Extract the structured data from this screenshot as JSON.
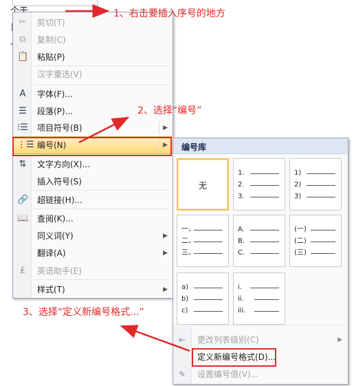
{
  "document": {
    "line1": "个于",
    "marks": [
      "日",
      "人"
    ]
  },
  "context_menu": {
    "items": [
      {
        "label": "剪切(T)",
        "icon": "scissors-icon",
        "glyph": "✂",
        "disabled": true
      },
      {
        "label": "复制(C)",
        "icon": "copy-icon",
        "glyph": "⧉",
        "disabled": true
      },
      {
        "label": "粘贴(P)",
        "icon": "paste-icon",
        "glyph": "📋",
        "disabled": false
      },
      {
        "label": "汉字重选(V)",
        "icon": "",
        "glyph": "",
        "disabled": true
      },
      {
        "label": "字体(F)...",
        "icon": "font-icon",
        "glyph": "A",
        "disabled": false
      },
      {
        "label": "段落(P)...",
        "icon": "paragraph-icon",
        "glyph": "☰",
        "disabled": false
      },
      {
        "label": "项目符号(B)",
        "icon": "bullets-icon",
        "glyph": "⁝☰",
        "disabled": false,
        "submenu": true
      },
      {
        "label": "编号(N)",
        "icon": "numbering-icon",
        "glyph": "⋮☰",
        "disabled": false,
        "submenu": true,
        "highlighted": true
      },
      {
        "label": "文字方向(X)...",
        "icon": "text-direction-icon",
        "glyph": "⇅",
        "disabled": false
      },
      {
        "label": "插入符号(S)",
        "icon": "",
        "glyph": "",
        "disabled": false
      },
      {
        "label": "超链接(H)...",
        "icon": "hyperlink-icon",
        "glyph": "🔗",
        "disabled": false
      },
      {
        "label": "查阅(K)...",
        "icon": "research-icon",
        "glyph": "📖",
        "disabled": false
      },
      {
        "label": "同义词(Y)",
        "icon": "",
        "glyph": "",
        "disabled": false,
        "submenu": true
      },
      {
        "label": "翻译(A)",
        "icon": "",
        "glyph": "",
        "disabled": false,
        "submenu": true
      },
      {
        "label": "英语助手(E)",
        "icon": "english-assistant-icon",
        "glyph": "₤",
        "disabled": true
      },
      {
        "label": "样式(T)",
        "icon": "",
        "glyph": "",
        "disabled": false,
        "submenu": true
      }
    ]
  },
  "numbering_submenu": {
    "header": "编号库",
    "none_label": "无",
    "tiles": [
      [
        "1.",
        "2.",
        "3."
      ],
      [
        "1)",
        "2)",
        "3)"
      ],
      [
        "一、",
        "二、",
        "三、"
      ],
      [
        "A.",
        "B.",
        "C."
      ],
      [
        "(一)",
        "(二)",
        "(三)"
      ],
      [
        "a)",
        "b)",
        "c)"
      ],
      [
        "i.",
        "ii.",
        "iii."
      ]
    ],
    "items": [
      {
        "label": "更改列表级别(C)",
        "disabled": true,
        "submenu": true,
        "icon": "indent-level-icon",
        "glyph": "⇤"
      },
      {
        "label": "定义新编号格式(D)...",
        "disabled": false,
        "submenu": false,
        "icon": "",
        "glyph": ""
      },
      {
        "label": "设置编号值(V)...",
        "disabled": true,
        "submenu": false,
        "icon": "set-value-icon",
        "glyph": "✎"
      }
    ]
  },
  "annotations": {
    "step1": "1、右击要插入序号的地方",
    "step2": "2、选择“编号”",
    "step3": "3、选择“定义新编号格式...”"
  },
  "colors": {
    "annotation": "#e02a2a",
    "highlight": "#ffd77a",
    "header": "#dde6f2"
  }
}
